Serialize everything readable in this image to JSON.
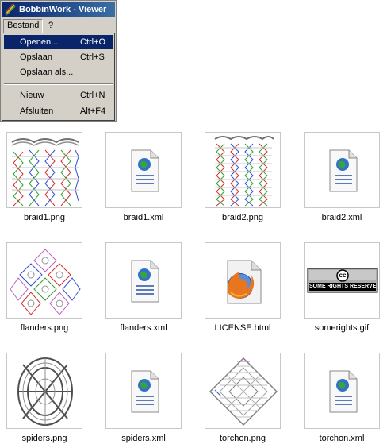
{
  "window": {
    "title": "BobbinWork - Viewer"
  },
  "menubar": {
    "items": [
      {
        "label": "Bestand"
      },
      {
        "label": "?"
      }
    ]
  },
  "file_menu": {
    "items": [
      {
        "label": "Openen...",
        "shortcut": "Ctrl+O"
      },
      {
        "label": "Opslaan",
        "shortcut": "Ctrl+S"
      },
      {
        "label": "Opslaan als...",
        "shortcut": ""
      },
      {
        "label": "Nieuw",
        "shortcut": "Ctrl+N"
      },
      {
        "label": "Afsluiten",
        "shortcut": "Alt+F4"
      }
    ]
  },
  "files": [
    {
      "name": "braid1.png",
      "icon": "braid-diagram-icon"
    },
    {
      "name": "braid1.xml",
      "icon": "xml-document-icon"
    },
    {
      "name": "braid2.png",
      "icon": "braid-diagram-icon"
    },
    {
      "name": "braid2.xml",
      "icon": "xml-document-icon"
    },
    {
      "name": "flanders.png",
      "icon": "flanders-diagram-icon"
    },
    {
      "name": "flanders.xml",
      "icon": "xml-document-icon"
    },
    {
      "name": "LICENSE.html",
      "icon": "firefox-document-icon"
    },
    {
      "name": "somerights.gif",
      "icon": "cc-badge-icon"
    },
    {
      "name": "spiders.png",
      "icon": "spiders-diagram-icon"
    },
    {
      "name": "spiders.xml",
      "icon": "xml-document-icon"
    },
    {
      "name": "torchon.png",
      "icon": "torchon-diagram-icon"
    },
    {
      "name": "torchon.xml",
      "icon": "xml-document-icon"
    }
  ],
  "badge": {
    "cc_mark": "cc",
    "text": "SOME RIGHTS RESERVED"
  },
  "colors": {
    "title_start": "#0a246a",
    "title_end": "#3a6ea5",
    "selection": "#0a246a",
    "face": "#d4d0c8"
  }
}
